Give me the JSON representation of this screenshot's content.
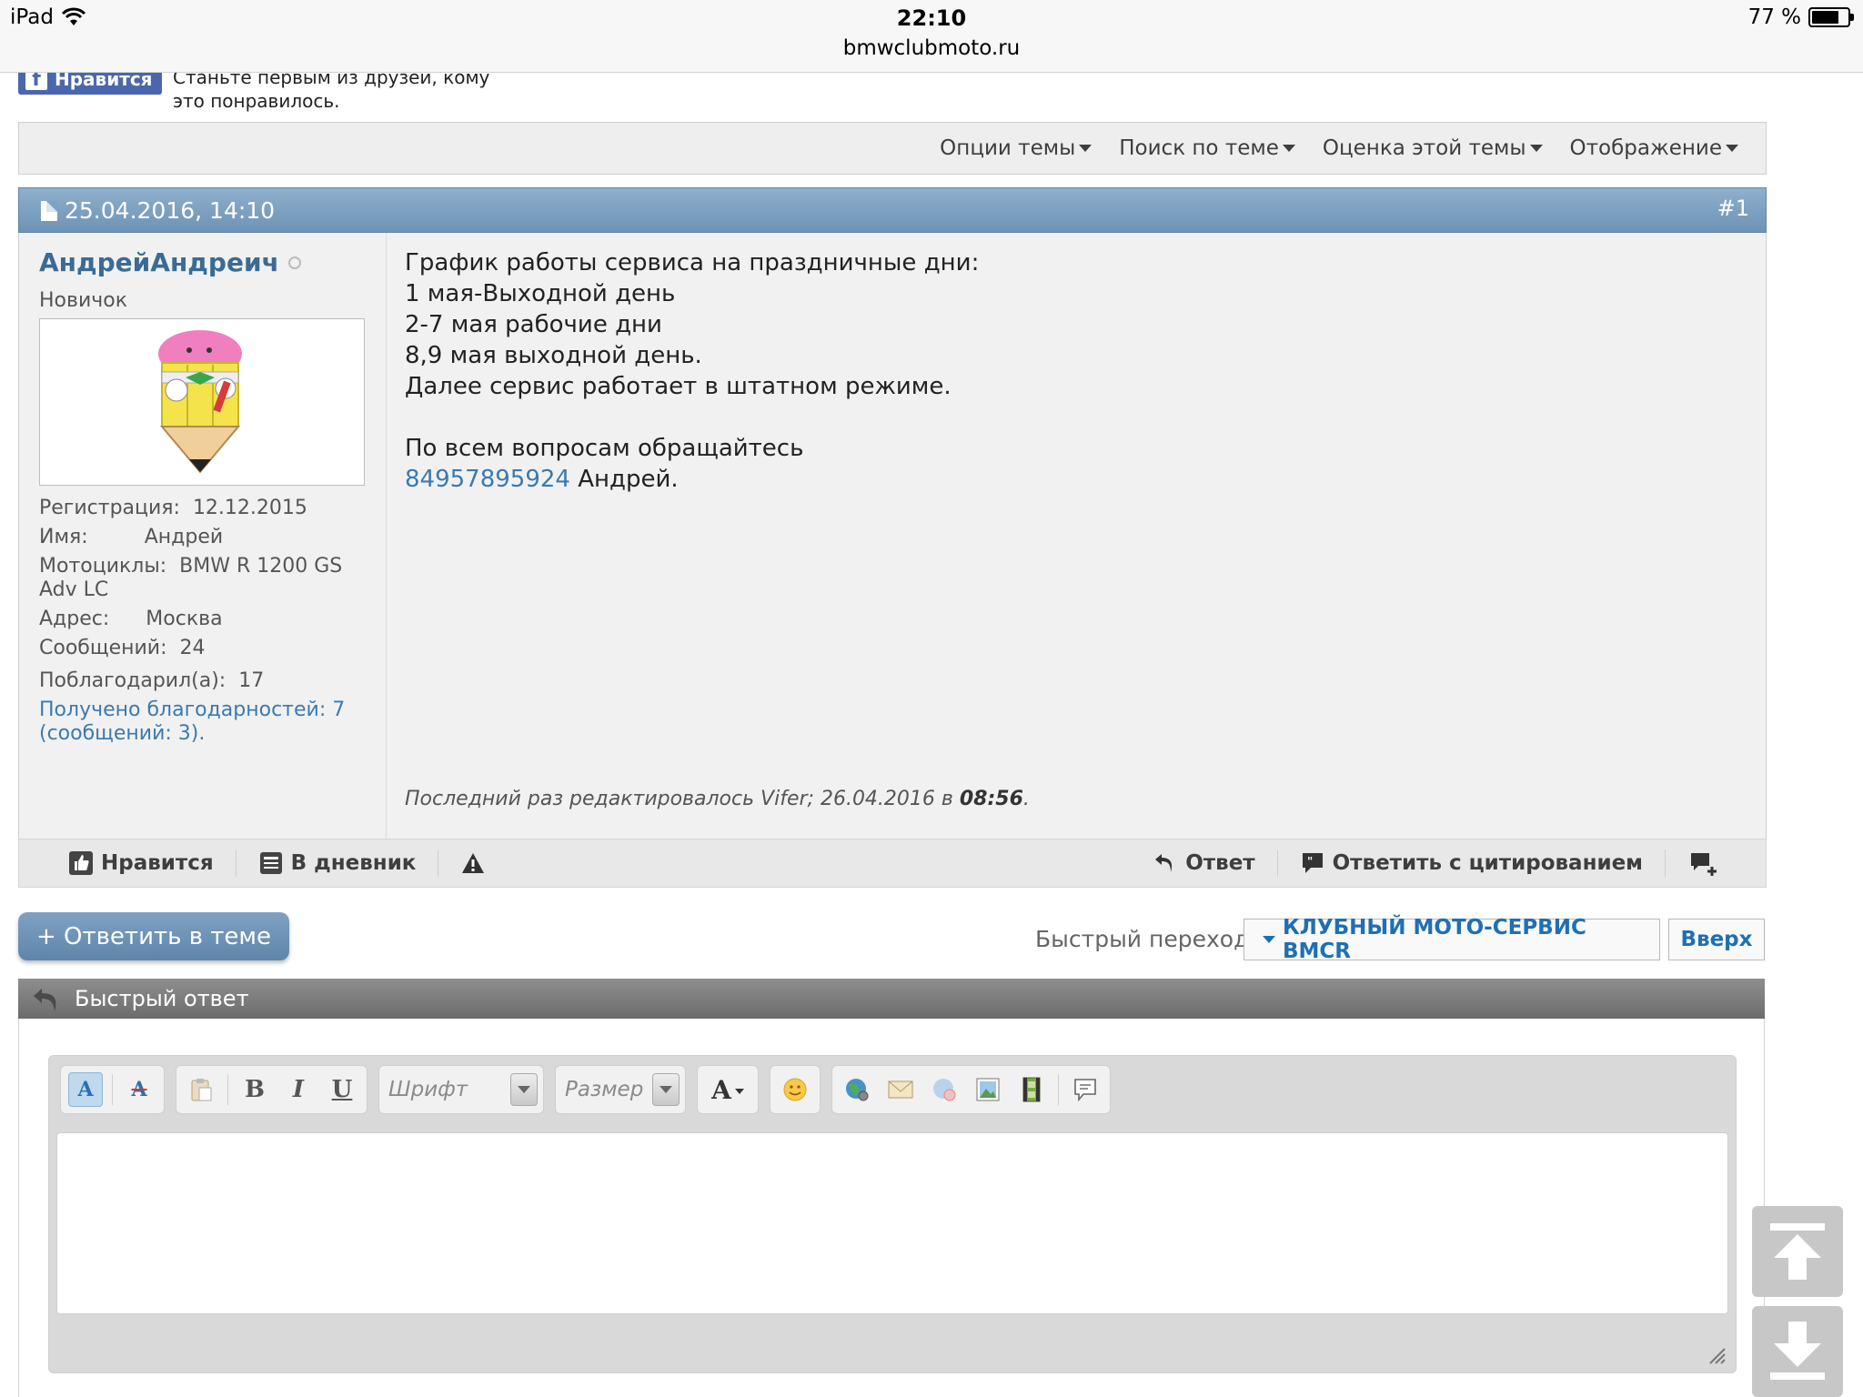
{
  "status_bar": {
    "device": "iPad",
    "time": "22:10",
    "url": "bmwclubmoto.ru",
    "battery": "77 %",
    "battery_level": 0.77
  },
  "facebook": {
    "button_label": "Нравится",
    "icon_letter": "f",
    "text": "Станьте первым из друзей, кому это понравилось."
  },
  "thread_tools": {
    "items": [
      "Опции темы",
      "Поиск по теме",
      "Оценка этой темы",
      "Отображение"
    ]
  },
  "post": {
    "date": "25.04.2016, 14:10",
    "number": "#1",
    "username": "АндрейАндреич",
    "user_title": "Новичок",
    "stats": {
      "reg_label": "Регистрация:",
      "reg_value": "12.12.2015",
      "name_label": "Имя:",
      "name_value": "Андрей",
      "moto_label": "Мотоциклы:",
      "moto_value": "BMW R 1200 GS Adv LC",
      "addr_label": "Адрес:",
      "addr_value": "Москва",
      "msgs_label": "Сообщений:",
      "msgs_value": "24",
      "thanked_label": "Поблагодарил(а):",
      "thanked_value": "17",
      "received": "Получено благодарностей: 7 (сообщений: 3)."
    },
    "message": {
      "line1": "График работы сервиса на праздничные дни:",
      "line2": "1 мая-Выходной день",
      "line3": "2-7 мая рабочие дни",
      "line4": "8,9 мая выходной день.",
      "line5": "Далее сервис работает в штатном режиме.",
      "line6": "По всем вопросам обращайтесь",
      "phone": "84957895924",
      "signoff": "Андрей."
    },
    "edit_note": {
      "prefix": "Последний раз редактировалось Vifer; 26.04.2016 в",
      "time": "08:56",
      "suffix": "."
    },
    "footer": {
      "like": "Нравится",
      "diary": "В дневник",
      "reply": "Ответ",
      "quote": "Ответить с цитированием"
    }
  },
  "reply_bar": {
    "reply_button": "+ Ответить в теме",
    "quick_nav_label": "Быстрый переход",
    "quick_nav_value": "КЛУБНЫЙ МОТО-СЕРВИС BMCR",
    "top_button": "Вверх"
  },
  "quick_reply": {
    "title": "Быстрый ответ",
    "font_placeholder": "Шрифт",
    "size_placeholder": "Размер",
    "bold": "B",
    "italic": "I",
    "underline": "U",
    "color": "A"
  },
  "colors": {
    "accent": "#3a6b95",
    "link": "#3a7ab0",
    "header_bar": "#7ea3c2",
    "facebook": "#4a66ad"
  }
}
